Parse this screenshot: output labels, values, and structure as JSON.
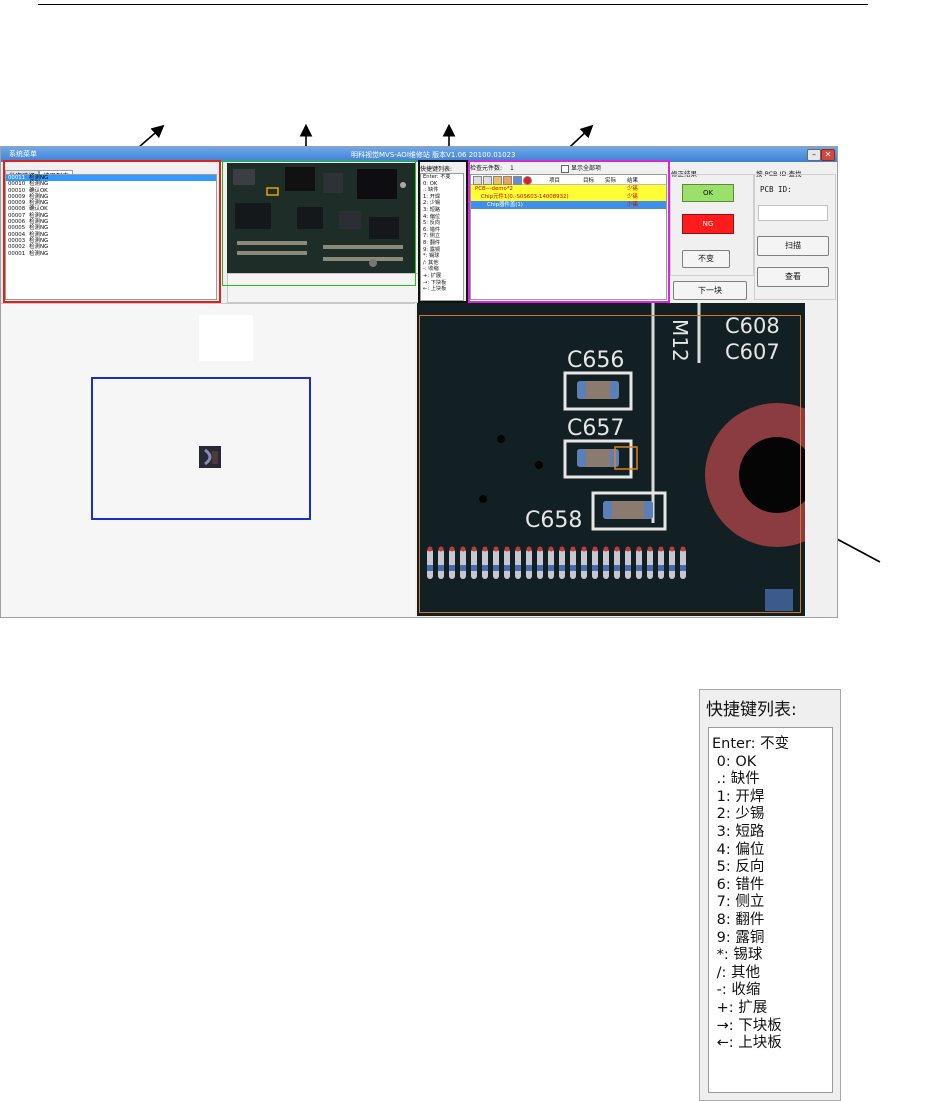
{
  "app": {
    "menu_label": "系统菜单",
    "window_title": "明科视觉MVS-AOI维修站  版本V1.06  20100.01023",
    "tabs": [
      {
        "label": "批次选择"
      },
      {
        "label": "结果列表"
      }
    ],
    "result_list": [
      {
        "id": "00011",
        "status": "检测NG",
        "selected": true
      },
      {
        "id": "00010",
        "status": "检测NG"
      },
      {
        "id": "00010",
        "status": "确认OK"
      },
      {
        "id": "00009",
        "status": "检测NG"
      },
      {
        "id": "00009",
        "status": "检测NG"
      },
      {
        "id": "00008",
        "status": "确认OK"
      },
      {
        "id": "00007",
        "status": "检测NG"
      },
      {
        "id": "00006",
        "status": "检测NG"
      },
      {
        "id": "00005",
        "status": "检测NG"
      },
      {
        "id": "00004",
        "status": "检测NG"
      },
      {
        "id": "00003",
        "status": "检测NG"
      },
      {
        "id": "00002",
        "status": "检测NG"
      },
      {
        "id": "00001",
        "status": "检测NG"
      }
    ],
    "shortcut_mini_title": "快捷键列表:",
    "component_count_label": "检查元件数:",
    "component_count": "1",
    "show_all_label": "显示全部项",
    "table_headers": [
      "项目",
      "目标",
      "实际",
      "结果"
    ],
    "table_rows": [
      {
        "name": "PCB---demo*2",
        "result": "少锡",
        "style": "yellow"
      },
      {
        "name": "Chip元件1(0.-S0S603-14008932)",
        "result": "少锡",
        "style": "yellow"
      },
      {
        "name": "Chip器件盖(1)",
        "result": "少锡",
        "style": "blue"
      }
    ],
    "correction_label": "修正结果",
    "ok_label": "OK",
    "ng_label": "NG",
    "same_label": "不变",
    "next_label": "下一块",
    "search_label": "按 PCB ID 查找",
    "pcb_id_label": "PCB ID:",
    "scan_label": "扫描",
    "view_label": "查看",
    "pcb_silkscreen": [
      "C656",
      "C657",
      "C658",
      "M12",
      "C608",
      "C607"
    ]
  },
  "shortcut_panel": {
    "title": "快捷键列表:",
    "rows": [
      "Enter: 不变",
      " 0: OK",
      " .: 缺件",
      " 1: 开焊",
      " 2: 少锡",
      " 3: 短路",
      " 4: 偏位",
      " 5: 反向",
      " 6: 错件",
      " 7: 侧立",
      " 8: 翻件",
      " 9: 露铜",
      " *: 锡球",
      " /: 其他",
      " -: 收缩",
      " +: 扩展",
      " →: 下块板",
      " ←: 上块板"
    ]
  },
  "colors": {
    "titlebar": "#3c7fd6",
    "selection": "#3399ff",
    "ok_button": "#9be06a",
    "ng_button": "#ff1c1c",
    "highlight_row": "#ffff33",
    "red_box": "#e0201a",
    "green_box": "#21c21a",
    "magenta_box": "#d62ad6",
    "blue_box": "#1c2ec9",
    "orange_box": "#d4762a"
  }
}
